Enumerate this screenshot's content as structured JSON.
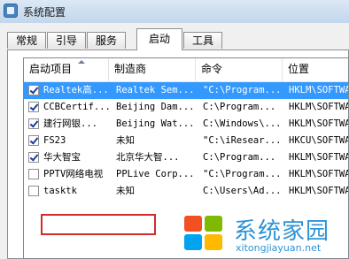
{
  "window": {
    "title": "系统配置"
  },
  "tabs": [
    {
      "label": "常规"
    },
    {
      "label": "引导"
    },
    {
      "label": "服务"
    },
    {
      "label": "启动"
    },
    {
      "label": "工具"
    }
  ],
  "active_tab": "启动",
  "table": {
    "columns": [
      "启动项目",
      "制造商",
      "命令",
      "位置"
    ],
    "rows": [
      {
        "checked": true,
        "selected": true,
        "item": "Realtek高...",
        "maker": "Realtek Sem...",
        "command": "\"C:\\Program...",
        "location": "HKLM\\SOFTWAR"
      },
      {
        "checked": true,
        "selected": false,
        "item": "CCBCertif...",
        "maker": "Beijing Dam...",
        "command": "C:\\Program...",
        "location": "HKLM\\SOFTWAR"
      },
      {
        "checked": true,
        "selected": false,
        "item": "建行网银...",
        "maker": "Beijing Wat...",
        "command": "C:\\Windows\\...",
        "location": "HKLM\\SOFTWAR"
      },
      {
        "checked": true,
        "selected": false,
        "item": "FS23",
        "maker": "未知",
        "command": "\"C:\\iResear...",
        "location": "HKCU\\SOFTWAR"
      },
      {
        "checked": true,
        "selected": false,
        "item": "华大智宝",
        "maker": "北京华大智...",
        "command": "C:\\Program...",
        "location": "HKLM\\SOFTWAR"
      },
      {
        "checked": false,
        "selected": false,
        "item": "PPTV网络电视",
        "maker": "PPLive Corp...",
        "command": "\"C:\\Program...",
        "location": "HKLM\\SOFTWAR"
      },
      {
        "checked": false,
        "selected": false,
        "item": "tasktk",
        "maker": "未知",
        "command": "C:\\Users\\Ad...",
        "location": "HKLM\\SOFTWAR"
      }
    ]
  },
  "watermark": {
    "title": "系统家园",
    "url": "xitongjiayuan.net"
  },
  "colors": {
    "selection": "#3399ff",
    "highlight_box": "#d42b2b",
    "watermark": "#2c93d8"
  }
}
